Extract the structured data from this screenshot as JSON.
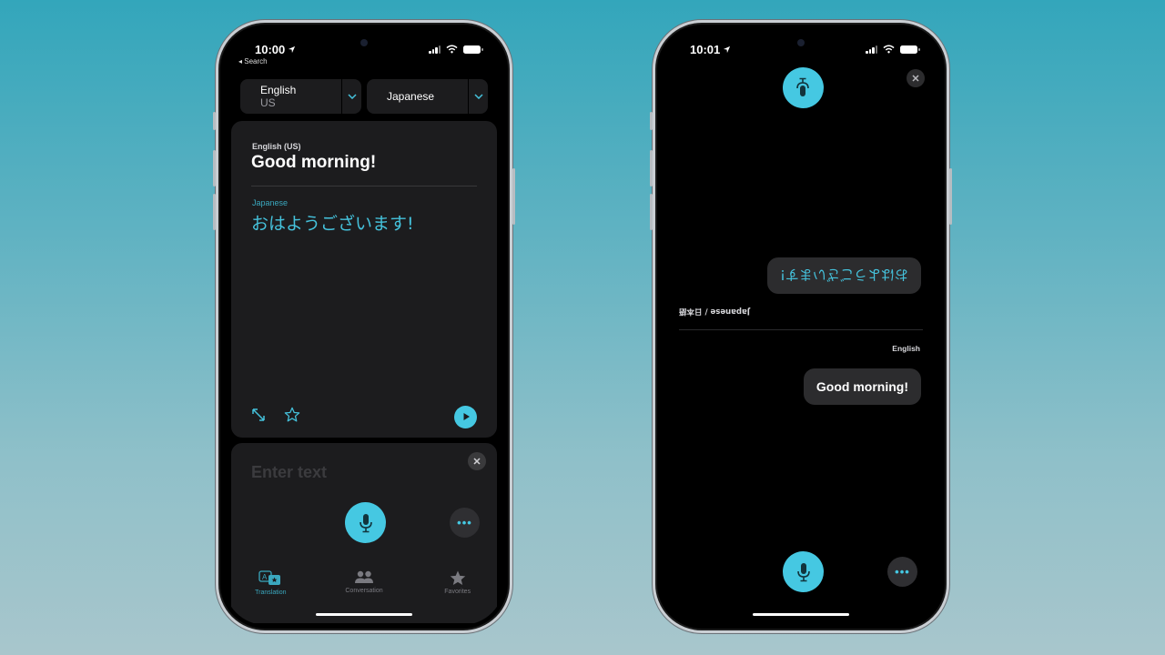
{
  "colors": {
    "accent": "#45c8e2",
    "accent_text": "#45c2dc",
    "card_bg": "#1c1c1e",
    "screen_bg": "#000000",
    "background_top": "#33a6bb",
    "background_bottom": "#a8c6cc"
  },
  "left_phone": {
    "status": {
      "time": "10:00",
      "location_icon": "location-arrow-icon",
      "back_label": "◂ Search"
    },
    "source_language": {
      "name": "English",
      "region": "US"
    },
    "target_language": {
      "name": "Japanese"
    },
    "result": {
      "source_label": "English (US)",
      "source_text": "Good morning!",
      "target_label": "Japanese",
      "target_text": "おはようございます!"
    },
    "input": {
      "placeholder": "Enter text",
      "value": ""
    },
    "more_label": "•••",
    "tabs": [
      {
        "label": "Translation",
        "icon": "translate-bubbles-icon",
        "active": true
      },
      {
        "label": "Conversation",
        "icon": "people-icon",
        "active": false
      },
      {
        "label": "Favorites",
        "icon": "star-icon",
        "active": false
      }
    ]
  },
  "right_phone": {
    "status": {
      "time": "10:01",
      "location_icon": "location-arrow-icon"
    },
    "messages": [
      {
        "language_label": "Japanese / 日本語",
        "text": "おはようございます!",
        "flipped": true
      },
      {
        "language_label": "English",
        "text": "Good morning!",
        "flipped": false
      }
    ],
    "more_label": "•••"
  }
}
